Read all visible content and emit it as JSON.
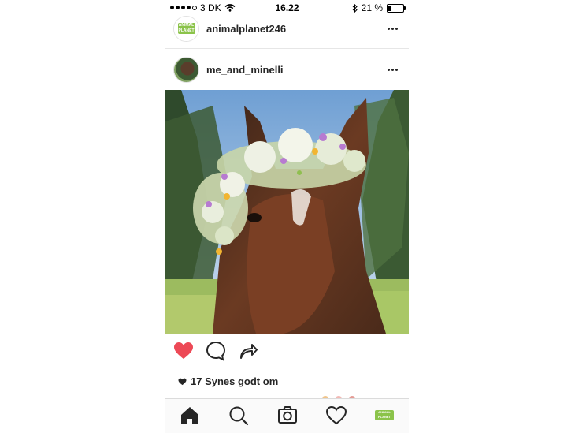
{
  "status": {
    "carrier": "3 DK",
    "time": "16.22",
    "battery_text": "21 %",
    "battery_level": 0.21
  },
  "header_row": {
    "username": "animalplanet246",
    "logo_text": "ANIMAL PLANET"
  },
  "post": {
    "username": "me_and_minelli",
    "likes_text": "17 Synes godt om",
    "liked": true,
    "heart_color": "#ed4956"
  },
  "icons": {
    "more": "more-options-icon",
    "heart": "heart-icon",
    "comment": "comment-icon",
    "share": "share-icon",
    "home": "home-icon",
    "search": "search-icon",
    "camera": "camera-icon",
    "activity": "activity-heart-icon",
    "profile": "profile-avatar-icon"
  }
}
